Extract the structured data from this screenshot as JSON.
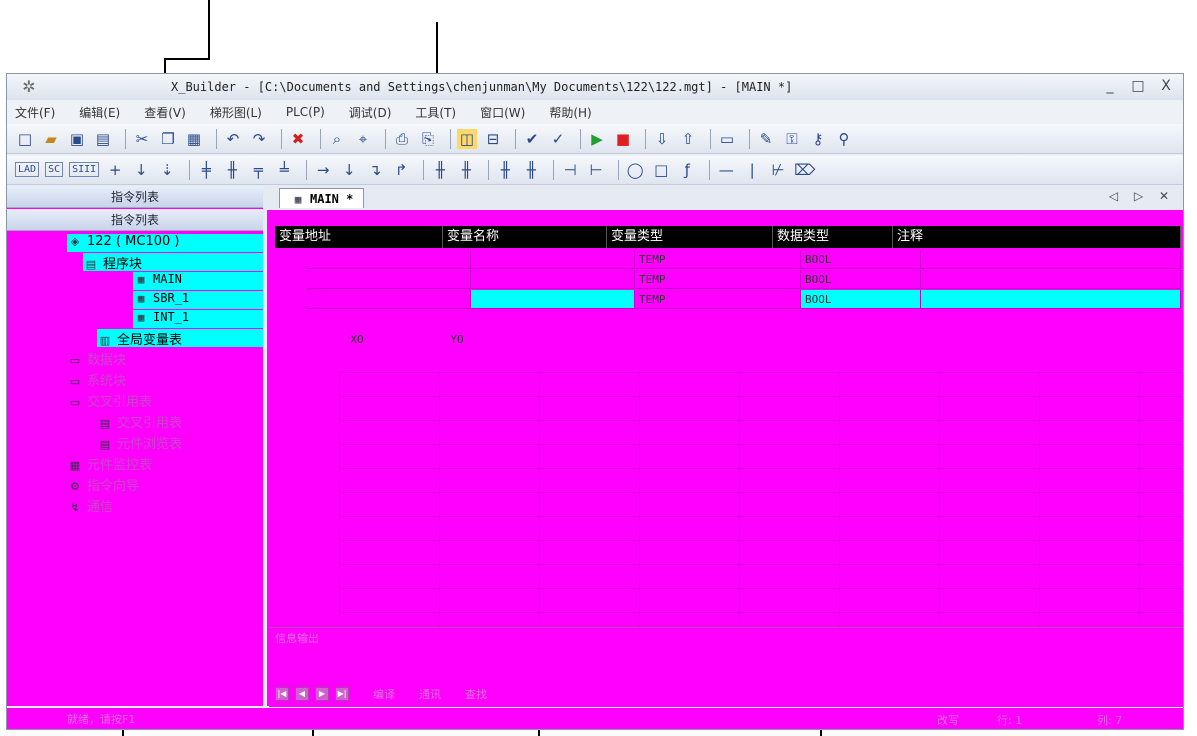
{
  "window": {
    "title": "X_Builder - [C:\\Documents and Settings\\chenjunman\\My Documents\\122\\122.mgt] - [MAIN *]",
    "controls": [
      "_",
      "□",
      "X"
    ]
  },
  "menu": [
    "文件(F)",
    "编辑(E)",
    "查看(V)",
    "梯形图(L)",
    "PLC(P)",
    "调试(D)",
    "工具(T)",
    "窗口(W)",
    "帮助(H)"
  ],
  "toolbar1": [
    "new-icon",
    "open-icon",
    "save-icon",
    "save-all-icon",
    "cut-icon",
    "copy-icon",
    "paste-icon",
    "undo-icon",
    "redo-icon",
    "delete-icon",
    "find-icon",
    "replace-icon",
    "preview-icon",
    "print-icon",
    "layout-icon",
    "layout2-icon",
    "check-icon",
    "check-all-icon",
    "run-icon",
    "stop-icon",
    "download-icon",
    "upload-icon",
    "monitor-icon",
    "edit-icon",
    "lock-icon",
    "unlock-icon",
    "key-icon"
  ],
  "toolbar2": {
    "modes": [
      "LAD",
      "SC",
      "SIII"
    ],
    "icons": [
      "plus-icon",
      "down-arrow-icon",
      "down-arrow2-icon",
      "branch-icon",
      "branch2-icon",
      "branch3-icon",
      "branch4-icon",
      "right-arrow-icon",
      "down-icon",
      "corner-icon",
      "corner2-icon",
      "contact-icon",
      "nc-contact-icon",
      "contact-p-icon",
      "contact-n-icon",
      "cmp-icon",
      "cmp2-icon",
      "coil-icon",
      "box-icon",
      "func-icon",
      "hline-icon",
      "vline-icon",
      "slash-icon",
      "del-icon"
    ]
  },
  "left_pane": {
    "header1": "指令列表",
    "header2": "指令列表",
    "tree": {
      "root": "122 ( MC100 )",
      "program_block": "程序块",
      "programs": [
        "MAIN",
        "SBR_1",
        "INT_1"
      ],
      "global_vars": "全局变量表",
      "others": [
        "数据块",
        "系统块",
        "交叉引用表",
        "交叉引用表",
        "元件浏览表",
        "元件监控表",
        "指令向导",
        "通信"
      ]
    }
  },
  "editor": {
    "tab": "MAIN *",
    "tab_nav": "◁ ▷ ✕",
    "var_table": {
      "headers": [
        "变量地址",
        "变量名称",
        "变量类型",
        "数据类型",
        "注释"
      ],
      "rows": [
        {
          "type": "TEMP",
          "dtype": "BOOL"
        },
        {
          "type": "TEMP",
          "dtype": "BOOL"
        },
        {
          "type": "TEMP",
          "dtype": "BOOL"
        }
      ]
    },
    "ladder": {
      "contacts": [
        "XO",
        "YO"
      ]
    }
  },
  "output": {
    "title": "信息输出",
    "tabs": [
      "编译",
      "通讯",
      "查找"
    ]
  },
  "statusbar": {
    "text": "就绪，请按F1",
    "mode": "改写",
    "row_label": "行:",
    "row_value": "1",
    "col_label": "列:",
    "col_value": "7"
  }
}
